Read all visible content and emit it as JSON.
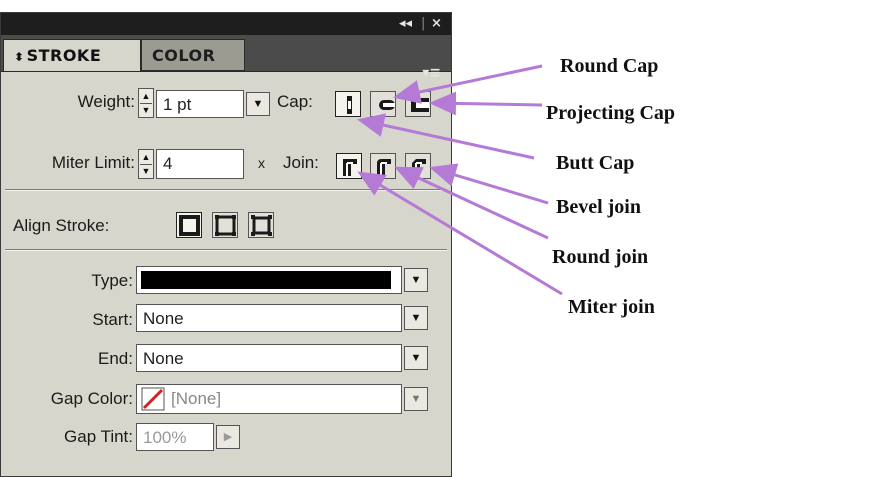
{
  "panel": {
    "titlebar": {
      "collapse_glyph": "◂◂",
      "separator": "|",
      "close_glyph": "×"
    },
    "tabs": [
      {
        "label": "STROKE",
        "arrows": "⬍",
        "active": true
      },
      {
        "label": "COLOR",
        "active": false
      }
    ],
    "menu_glyph": "▾≡",
    "weight": {
      "label": "Weight:",
      "value": "1 pt"
    },
    "cap": {
      "label": "Cap:",
      "options": [
        "butt-cap",
        "round-cap",
        "projecting-cap"
      ],
      "selected": "butt-cap"
    },
    "miter": {
      "label": "Miter Limit:",
      "value": "4",
      "unit": "x"
    },
    "join": {
      "label": "Join:",
      "options": [
        "miter-join",
        "round-join",
        "bevel-join"
      ],
      "selected": "miter-join"
    },
    "align_stroke": {
      "label": "Align Stroke:",
      "options": [
        "align-center",
        "align-inside",
        "align-outside"
      ],
      "selected": "align-center"
    },
    "type": {
      "label": "Type:",
      "swatch_color": "#000000"
    },
    "start": {
      "label": "Start:",
      "value": "None"
    },
    "end": {
      "label": "End:",
      "value": "None"
    },
    "gap_color": {
      "label": "Gap Color:",
      "value": "[None]",
      "none_slash_color": "#d42020"
    },
    "gap_tint": {
      "label": "Gap Tint:",
      "value": "100%"
    }
  },
  "callouts": {
    "round_cap": "Round Cap",
    "projecting_cap": "Projecting Cap",
    "butt_cap": "Butt Cap",
    "bevel_join": "Bevel join",
    "round_join": "Round join",
    "miter_join": "Miter join",
    "arrow_color": "#b47ad6"
  }
}
